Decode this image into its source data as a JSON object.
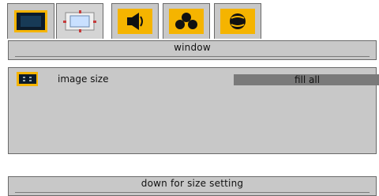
{
  "tabs": [
    {
      "icon": "monitor-icon"
    },
    {
      "icon": "window-frame-icon"
    },
    {
      "icon": "speaker-icon"
    },
    {
      "icon": "network-nodes-icon"
    },
    {
      "icon": "globe-icon"
    }
  ],
  "header": {
    "title": "window"
  },
  "settings": {
    "rows": [
      {
        "icon": "image-size-icon",
        "label": "image size",
        "value": "fill all"
      }
    ]
  },
  "footer": {
    "hint": "down for size setting"
  },
  "colors": {
    "tab_background": "#c8c8c8",
    "accent_yellow": "#f5b400",
    "selected_value_bg": "#7a7a7a"
  }
}
